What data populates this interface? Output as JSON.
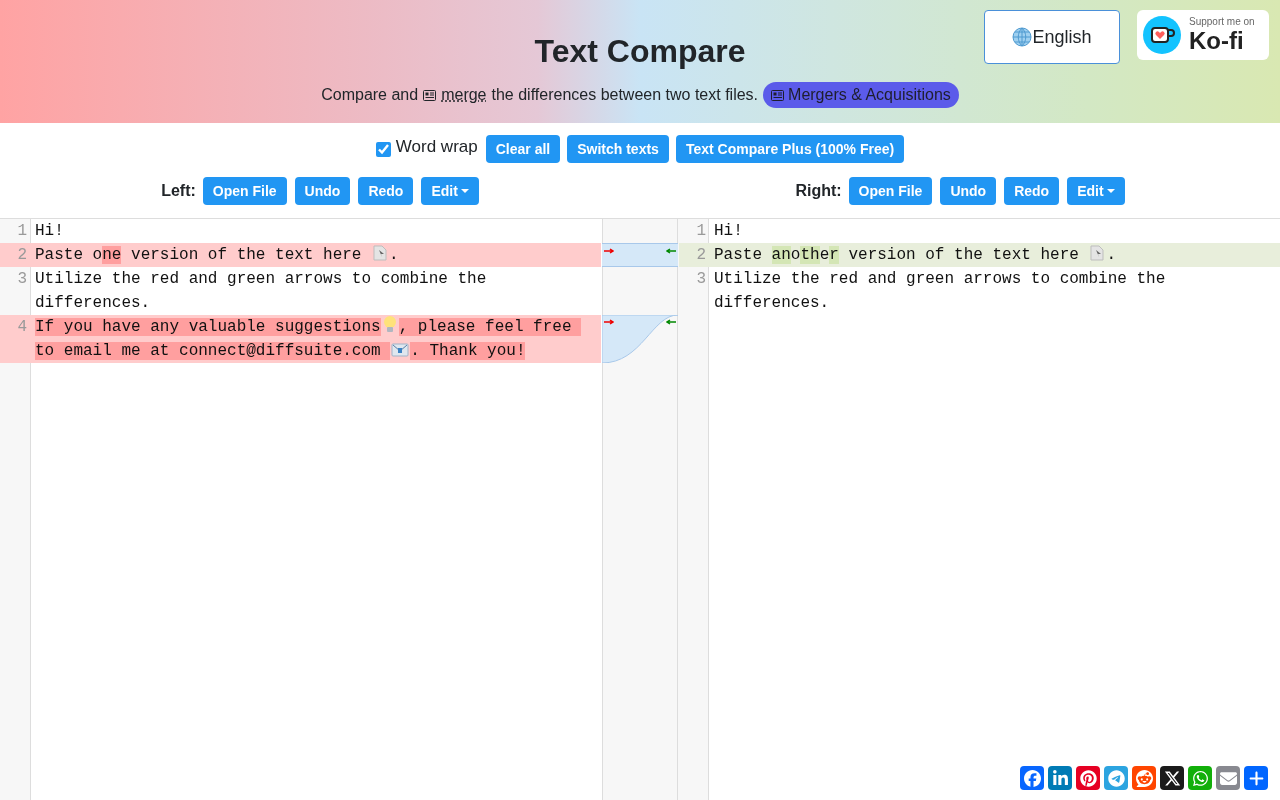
{
  "header": {
    "title": "Text Compare",
    "subtitle": {
      "before": "Compare and",
      "link": "merge",
      "after": "the differences between two text files."
    },
    "badge": "Mergers & Acquisitions",
    "language_button": "English",
    "kofi": {
      "caption": "Support me on",
      "name": "Ko-fi"
    }
  },
  "toolbar": {
    "word_wrap": {
      "label": "Word wrap",
      "checked": true
    },
    "buttons": [
      "Clear all",
      "Switch texts",
      "Text Compare Plus (100% Free)"
    ]
  },
  "left": {
    "label": "Left:",
    "buttons": [
      "Open File",
      "Undo",
      "Redo"
    ],
    "menu": "Edit"
  },
  "right": {
    "label": "Right:",
    "buttons": [
      "Open File",
      "Undo",
      "Redo"
    ],
    "menu": "Edit"
  },
  "editor_left": {
    "lines": [
      {
        "number": "1",
        "changed": false,
        "segments": [
          {
            "kind": "text",
            "text": "Hi!",
            "changed": false
          }
        ]
      },
      {
        "number": "2",
        "changed": true,
        "segments": [
          {
            "kind": "text",
            "text": "Paste o",
            "changed": false
          },
          {
            "kind": "text",
            "text": "ne",
            "changed": true
          },
          {
            "kind": "text",
            "text": " version of the text here ",
            "changed": false
          },
          {
            "kind": "page"
          },
          {
            "kind": "text",
            "text": ".",
            "changed": false
          }
        ]
      },
      {
        "number": "3",
        "changed": false,
        "segments": [
          {
            "kind": "text",
            "text": "Utilize the red and green arrows to combine the differences.",
            "changed": false
          }
        ]
      },
      {
        "number": "4",
        "changed": true,
        "segments": [
          {
            "kind": "text",
            "text": "If you have any valuable suggestions",
            "changed": true
          },
          {
            "kind": "bulb"
          },
          {
            "kind": "text",
            "text": ", please feel free to email me at connect@diffsuite.com ",
            "changed": true
          },
          {
            "kind": "mail"
          },
          {
            "kind": "text",
            "text": ". Thank you!",
            "changed": true
          }
        ]
      }
    ]
  },
  "editor_right": {
    "lines": [
      {
        "number": "1",
        "changed": false,
        "segments": [
          {
            "kind": "text",
            "text": "Hi!",
            "changed": false
          }
        ]
      },
      {
        "number": "2",
        "changed": true,
        "segments": [
          {
            "kind": "text",
            "text": "Paste ",
            "changed": false
          },
          {
            "kind": "text",
            "text": "an",
            "changed": true
          },
          {
            "kind": "text",
            "text": "o",
            "changed": false
          },
          {
            "kind": "text",
            "text": "th",
            "changed": true
          },
          {
            "kind": "text",
            "text": "e",
            "changed": false
          },
          {
            "kind": "text",
            "text": "r",
            "changed": true
          },
          {
            "kind": "text",
            "text": " version of the text here ",
            "changed": false
          },
          {
            "kind": "page"
          },
          {
            "kind": "text",
            "text": ".",
            "changed": false
          }
        ]
      },
      {
        "number": "3",
        "changed": false,
        "segments": [
          {
            "kind": "text",
            "text": "Utilize the red and green arrows to combine the differences.",
            "changed": false
          }
        ]
      }
    ]
  },
  "share": [
    {
      "kind": "facebook",
      "color": "#0866ff"
    },
    {
      "kind": "linkedin",
      "color": "#007bb5"
    },
    {
      "kind": "pinterest",
      "color": "#e60023"
    },
    {
      "kind": "telegram",
      "color": "#2ca4e0"
    },
    {
      "kind": "reddit",
      "color": "#ff4500"
    },
    {
      "kind": "x",
      "color": "#1a1a1a"
    },
    {
      "kind": "whatsapp",
      "color": "#12af0a"
    },
    {
      "kind": "email",
      "color": "#888990"
    },
    {
      "kind": "more",
      "color": "#0166ff"
    }
  ]
}
